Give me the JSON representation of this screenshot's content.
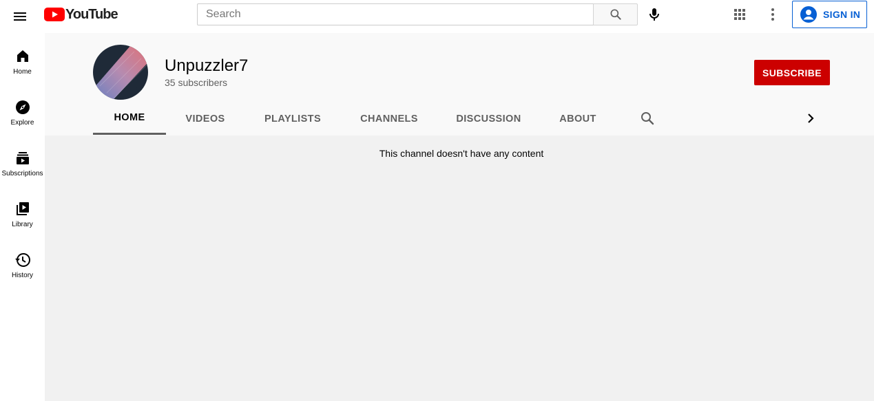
{
  "header": {
    "logo_text": "YouTube",
    "search_placeholder": "Search",
    "sign_in_label": "SIGN IN",
    "brand_color": "#ff0000",
    "accent_color": "#065fd4"
  },
  "guide": {
    "items": [
      {
        "label": "Home",
        "icon": "home-icon"
      },
      {
        "label": "Explore",
        "icon": "compass-icon"
      },
      {
        "label": "Subscriptions",
        "icon": "subscriptions-icon"
      },
      {
        "label": "Library",
        "icon": "library-icon"
      },
      {
        "label": "History",
        "icon": "history-icon"
      }
    ]
  },
  "channel": {
    "name": "Unpuzzler7",
    "subscribers": "35 subscribers",
    "subscribe_label": "SUBSCRIBE",
    "subscribe_color": "#cc0000"
  },
  "tabs": [
    {
      "label": "HOME",
      "active": true
    },
    {
      "label": "VIDEOS",
      "active": false
    },
    {
      "label": "PLAYLISTS",
      "active": false
    },
    {
      "label": "CHANNELS",
      "active": false
    },
    {
      "label": "DISCUSSION",
      "active": false
    },
    {
      "label": "ABOUT",
      "active": false
    }
  ],
  "content": {
    "empty_message": "This channel doesn't have any content"
  }
}
